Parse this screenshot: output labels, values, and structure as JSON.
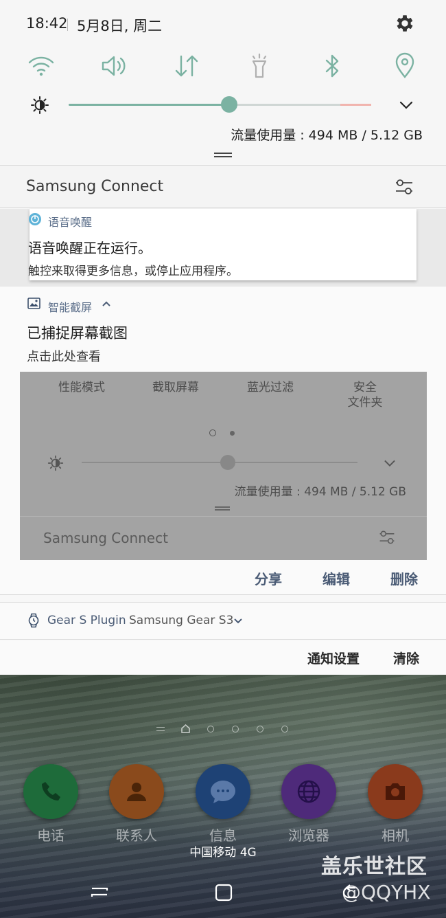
{
  "status_bar": {
    "time": "18:42",
    "date": "5月8日, 周二"
  },
  "quick_panel": {
    "toggles": [
      {
        "name": "wifi",
        "icon": "wifi-icon",
        "active": true
      },
      {
        "name": "sound",
        "icon": "volume-icon",
        "active": true
      },
      {
        "name": "mobile-data",
        "icon": "data-arrows-icon",
        "active": true
      },
      {
        "name": "flashlight",
        "icon": "flashlight-icon",
        "active": false
      },
      {
        "name": "bluetooth",
        "icon": "bluetooth-icon",
        "active": true
      },
      {
        "name": "location",
        "icon": "location-pin-icon",
        "active": true
      }
    ],
    "brightness_level": 0.53,
    "data_usage": "流量使用量 : 494 MB / 5.12 GB"
  },
  "samsung_connect": {
    "title": "Samsung Connect"
  },
  "voice_wake_notification": {
    "app": "语音唤醒",
    "title": "语音唤醒正在运行。",
    "subtitle": "触控来取得更多信息，或停止应用程序。"
  },
  "screenshot_notification": {
    "app": "智能截屏",
    "title": "已捕捉屏幕截图",
    "subtitle": "点击此处查看",
    "preview": {
      "tiles": [
        "性能模式",
        "截取屏幕",
        "蓝光过滤",
        "安全\n文件夹"
      ],
      "brightness_level": 0.53,
      "data_usage": "流量使用量 : 494 MB / 5.12 GB",
      "samsung_connect": "Samsung Connect"
    },
    "actions": {
      "share": "分享",
      "edit": "编辑",
      "delete": "删除"
    }
  },
  "gear_notification": {
    "app": "Gear S Plugin",
    "subtitle": "Samsung Gear S3"
  },
  "bottom_actions": {
    "settings": "通知设置",
    "clear": "清除"
  },
  "home_screen": {
    "dock": [
      {
        "label": "电话",
        "icon": "phone-icon",
        "color": "#1e6b3a"
      },
      {
        "label": "联系人",
        "icon": "contact-icon",
        "color": "#8a4a1c"
      },
      {
        "label": "信息",
        "icon": "message-icon",
        "color": "#1e4275"
      },
      {
        "label": "浏览器",
        "icon": "globe-icon",
        "color": "#4e2a7a"
      },
      {
        "label": "相机",
        "icon": "camera-icon",
        "color": "#8a3a1c"
      }
    ],
    "carrier": "中国移动 4G",
    "watermark": "盖乐世社区",
    "watermark_handle": "@QQYHX"
  },
  "colors": {
    "accent": "#7bb2a2",
    "action_text": "#4a5b75"
  }
}
